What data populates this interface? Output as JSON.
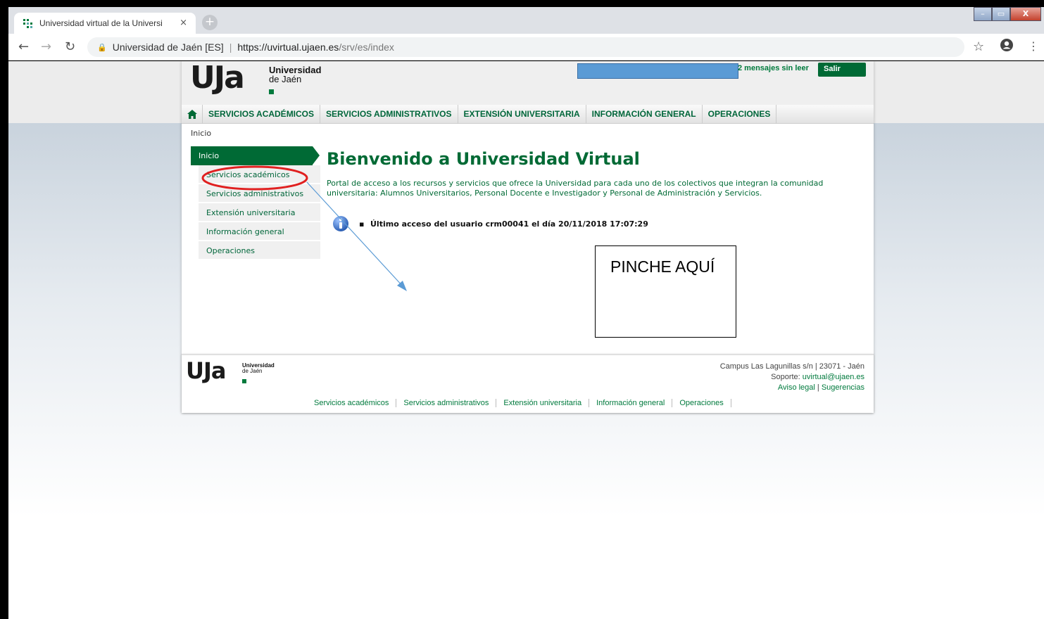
{
  "browser": {
    "tab_title": "Universidad virtual de la Universi",
    "tab_close": "×",
    "new_tab": "+",
    "window_min": "–",
    "window_max": "▭",
    "window_close": "X",
    "url_site_name": "Universidad de Jaén [ES]",
    "url_host": "https://uvirtual.ujaen.es",
    "url_path": "/srv/es/index"
  },
  "header": {
    "logo_letters": "UJa",
    "logo_line1": "Universidad",
    "logo_line2": "de Jaén",
    "messages": "2 mensajes sin leer",
    "logout_label": "Salir"
  },
  "main_nav": [
    {
      "label": "SERVICIOS ACADÉMICOS"
    },
    {
      "label": "SERVICIOS ADMINISTRATIVOS"
    },
    {
      "label": "EXTENSIÓN UNIVERSITARIA"
    },
    {
      "label": "INFORMACIÓN GENERAL"
    },
    {
      "label": "OPERACIONES"
    }
  ],
  "breadcrumb": "Inicio",
  "sidebar": {
    "active": "Inicio",
    "items": [
      {
        "label": "Servicios académicos"
      },
      {
        "label": "Servicios administrativos"
      },
      {
        "label": "Extensión universitaria"
      },
      {
        "label": "Información general"
      },
      {
        "label": "Operaciones"
      }
    ]
  },
  "content": {
    "title": "Bienvenido a Universidad Virtual",
    "intro": "Portal de acceso a los recursos y servicios que ofrece la Universidad para cada uno de los colectivos que integran la comunidad universitaria: Alumnos Universitarios, Personal Docente e Investigador y Personal de Administración y Servicios.",
    "last_access": "Último acceso del usuario crm00041 el día 20/11/2018 17:07:29"
  },
  "annotation": {
    "callout_text": "PINCHE AQUÍ",
    "highlight_color": "#e02020",
    "arrow_color": "#5b9bd5"
  },
  "footer": {
    "logo_letters": "UJa",
    "logo_line1": "Universidad",
    "logo_line2": "de Jaén",
    "address": "Campus Las Lagunillas s/n | 23071 - Jaén",
    "support_prefix": "Soporte: ",
    "support_email": "uvirtual@ujaen.es",
    "legal": "Aviso legal",
    "legal_sep": " | ",
    "suggestions": "Sugerencias",
    "links": [
      {
        "label": "Servicios académicos"
      },
      {
        "label": "Servicios administrativos"
      },
      {
        "label": "Extensión universitaria"
      },
      {
        "label": "Información general"
      },
      {
        "label": "Operaciones"
      }
    ]
  },
  "colors": {
    "brand_green": "#006a35",
    "brand_blue_box": "#5b9bd5"
  }
}
